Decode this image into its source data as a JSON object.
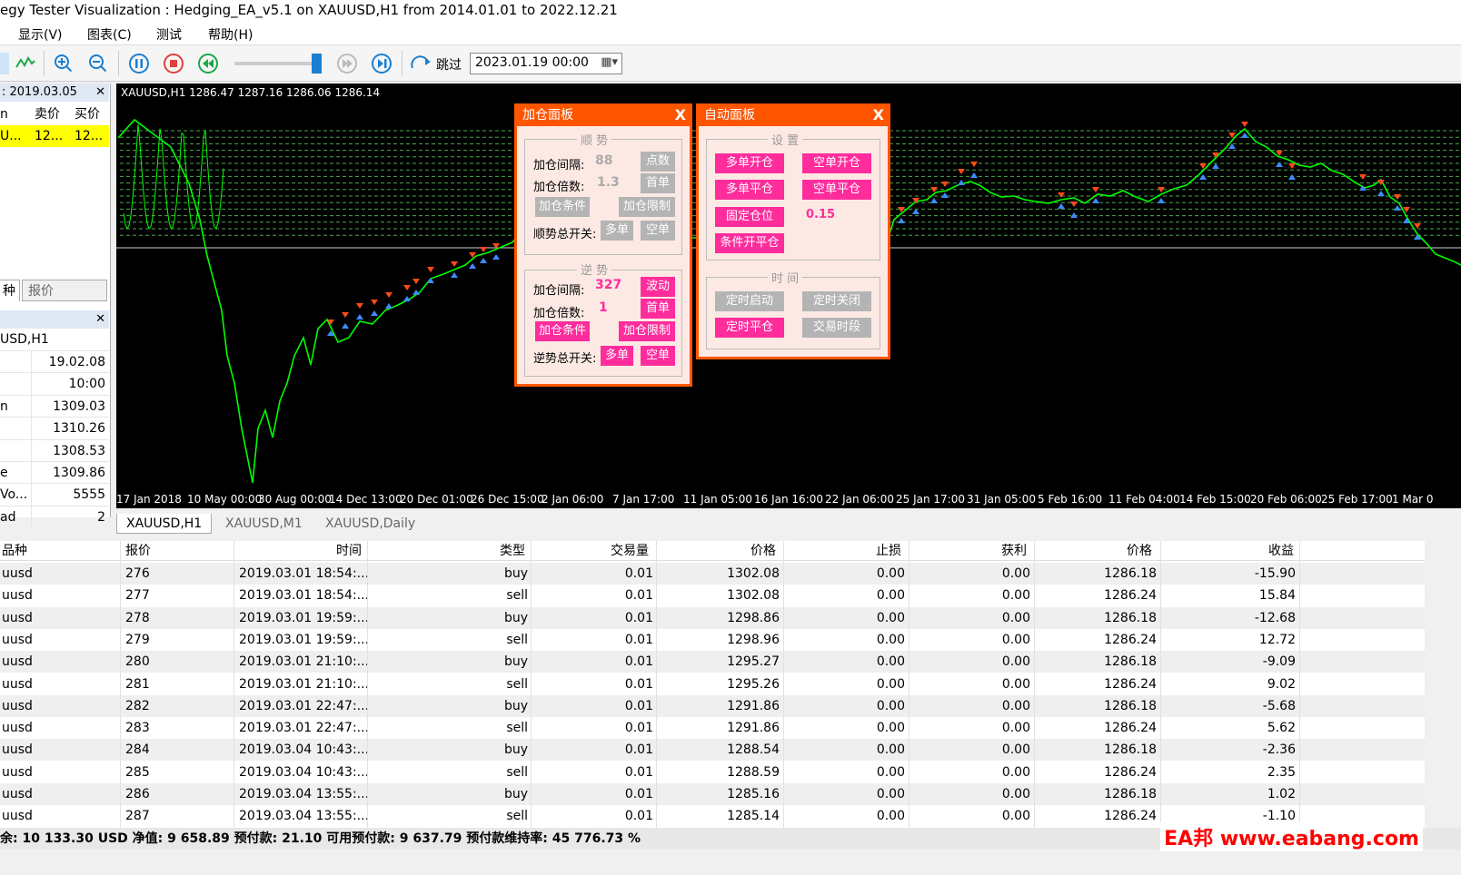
{
  "window": {
    "title": "egy Tester Visualization : Hedging_EA_v5.1 on XAUUSD,H1 from 2014.01.01 to 2022.12.21"
  },
  "menu": [
    "显示(V)",
    "图表(C)",
    "测试",
    "帮助(H)"
  ],
  "toolbar": {
    "jump_label": "跳过",
    "date_value": "2023.01.19 00:00",
    "speed_level": 0.9
  },
  "market_watch": {
    "header": ": 2019.03.05",
    "col_sell": "卖价",
    "col_buy": "买价",
    "row_symbol": "U...",
    "row_sell": "12...",
    "row_buy": "12...",
    "tab_symbols": "种",
    "tab_quotes": "报价"
  },
  "data_window": {
    "symbol": "USD,H1",
    "rows": [
      {
        "label": "",
        "value": "19.02.08"
      },
      {
        "label": "",
        "value": "10:00"
      },
      {
        "label": "n",
        "value": "1309.03"
      },
      {
        "label": "",
        "value": "1310.26"
      },
      {
        "label": "",
        "value": "1308.53"
      },
      {
        "label": "e",
        "value": "1309.86"
      },
      {
        "label": "Vo...",
        "value": "5555"
      },
      {
        "label": "ad",
        "value": "2"
      }
    ]
  },
  "chart": {
    "ohlc": "XAUUSD,H1  1286.47 1287.16 1286.06 1286.14",
    "xaxis": [
      "17 Jan 2018",
      "10 May 00:00",
      "30 Aug 00:00",
      "14 Dec 13:00",
      "20 Dec 01:00",
      "26 Dec 15:00",
      "2 Jan 06:00",
      "7 Jan 17:00",
      "11 Jan 05:00",
      "16 Jan 16:00",
      "22 Jan 06:00",
      "25 Jan 17:00",
      "31 Jan 05:00",
      "5 Feb 16:00",
      "11 Feb 04:00",
      "14 Feb 15:00",
      "20 Feb 06:00",
      "25 Feb 17:00",
      "1 Mar 0"
    ]
  },
  "add_panel": {
    "title": "加仓面板",
    "close": "X",
    "trend": {
      "title": "顺 势",
      "interval_label": "加仓间隔:",
      "interval_value": "88",
      "interval_btn": "点数",
      "multiplier_label": "加仓倍数:",
      "multiplier_value": "1.3",
      "multiplier_btn": "首单",
      "cond_btn": "加仓条件",
      "limit_btn": "加仓限制",
      "switch_label": "顺势总开关:",
      "long_btn": "多单",
      "short_btn": "空单"
    },
    "counter": {
      "title": "逆 势",
      "interval_label": "加仓间隔:",
      "interval_value": "327",
      "interval_btn": "波动",
      "multiplier_label": "加仓倍数:",
      "multiplier_value": "1",
      "multiplier_btn": "首单",
      "cond_btn": "加仓条件",
      "limit_btn": "加仓限制",
      "switch_label": "逆势总开关:",
      "long_btn": "多单",
      "short_btn": "空单"
    }
  },
  "auto_panel": {
    "title": "自动面板",
    "close": "X",
    "settings": {
      "title": "设 置",
      "open_long": "多单开仓",
      "open_short": "空单开仓",
      "close_long": "多单平仓",
      "close_short": "空单平仓",
      "fixed_lot": "固定仓位",
      "lot_value": "0.15",
      "cond_open": "条件开平仓"
    },
    "time": {
      "title": "时 间",
      "timer_start": "定时启动",
      "timer_stop": "定时关闭",
      "timer_close": "定时平仓",
      "session": "交易时段"
    }
  },
  "chart_tabs": [
    "XAUUSD,H1",
    "XAUUSD,M1",
    "XAUUSD,Daily"
  ],
  "orders": {
    "headers": [
      "品种",
      "报价",
      "时间",
      "类型",
      "交易量",
      "价格",
      "止损",
      "获利",
      "价格",
      "收益"
    ],
    "rows": [
      [
        "uusd",
        "276",
        "2019.03.01 18:54:...",
        "buy",
        "0.01",
        "1302.08",
        "0.00",
        "0.00",
        "1286.18",
        "-15.90"
      ],
      [
        "uusd",
        "277",
        "2019.03.01 18:54:...",
        "sell",
        "0.01",
        "1302.08",
        "0.00",
        "0.00",
        "1286.24",
        "15.84"
      ],
      [
        "uusd",
        "278",
        "2019.03.01 19:59:...",
        "buy",
        "0.01",
        "1298.86",
        "0.00",
        "0.00",
        "1286.18",
        "-12.68"
      ],
      [
        "uusd",
        "279",
        "2019.03.01 19:59:...",
        "sell",
        "0.01",
        "1298.96",
        "0.00",
        "0.00",
        "1286.24",
        "12.72"
      ],
      [
        "uusd",
        "280",
        "2019.03.01 21:10:...",
        "buy",
        "0.01",
        "1295.27",
        "0.00",
        "0.00",
        "1286.18",
        "-9.09"
      ],
      [
        "uusd",
        "281",
        "2019.03.01 21:10:...",
        "sell",
        "0.01",
        "1295.26",
        "0.00",
        "0.00",
        "1286.24",
        "9.02"
      ],
      [
        "uusd",
        "282",
        "2019.03.01 22:47:...",
        "buy",
        "0.01",
        "1291.86",
        "0.00",
        "0.00",
        "1286.18",
        "-5.68"
      ],
      [
        "uusd",
        "283",
        "2019.03.01 22:47:...",
        "sell",
        "0.01",
        "1291.86",
        "0.00",
        "0.00",
        "1286.24",
        "5.62"
      ],
      [
        "uusd",
        "284",
        "2019.03.04 10:43:...",
        "buy",
        "0.01",
        "1288.54",
        "0.00",
        "0.00",
        "1286.18",
        "-2.36"
      ],
      [
        "uusd",
        "285",
        "2019.03.04 10:43:...",
        "sell",
        "0.01",
        "1288.59",
        "0.00",
        "0.00",
        "1286.24",
        "2.35"
      ],
      [
        "uusd",
        "286",
        "2019.03.04 13:55:...",
        "buy",
        "0.01",
        "1285.16",
        "0.00",
        "0.00",
        "1286.18",
        "1.02"
      ],
      [
        "uusd",
        "287",
        "2019.03.04 13:55:...",
        "sell",
        "0.01",
        "1285.14",
        "0.00",
        "0.00",
        "1286.24",
        "-1.10"
      ]
    ]
  },
  "status": "余: 10 133.30 USD  净值: 9 658.89  预付款: 21.10  可用预付款: 9 637.79  预付款维持率: 45 776.73 %",
  "watermark": "EA邦 www.eabang.com",
  "colors": {
    "panel": "#ff5500",
    "pink_button": "#ff2c9c",
    "gray_button": "#b4b4b4",
    "price_line": "#00ff00",
    "selected_row": "#ffff00"
  }
}
